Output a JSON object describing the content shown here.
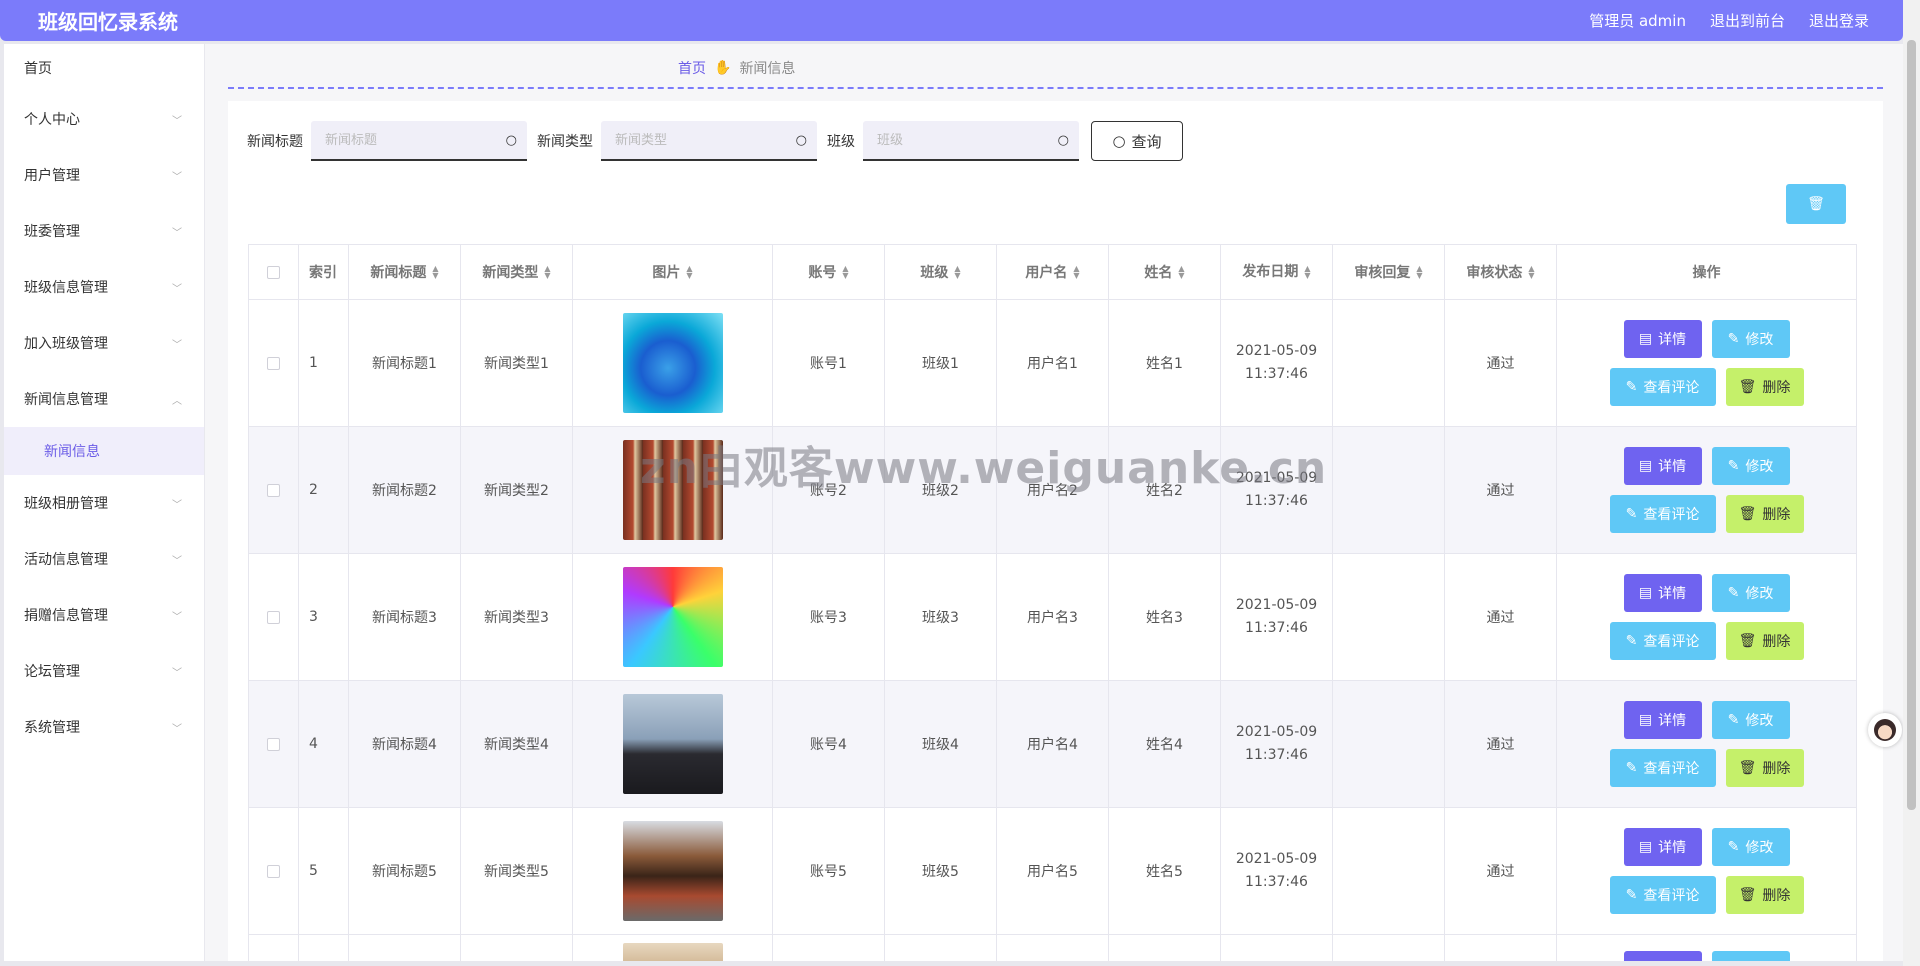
{
  "app": {
    "title": "班级回忆录系统"
  },
  "topbar": {
    "admin": "管理员 admin",
    "to_front": "退出到前台",
    "logout": "退出登录"
  },
  "sidebar": {
    "home": "首页",
    "items": [
      {
        "label": "个人中心"
      },
      {
        "label": "用户管理"
      },
      {
        "label": "班委管理"
      },
      {
        "label": "班级信息管理"
      },
      {
        "label": "加入班级管理"
      },
      {
        "label": "新闻信息管理"
      },
      {
        "label": "班级相册管理"
      },
      {
        "label": "活动信息管理"
      },
      {
        "label": "捐赠信息管理"
      },
      {
        "label": "论坛管理"
      },
      {
        "label": "系统管理"
      }
    ],
    "sub_active": "新闻信息"
  },
  "breadcrumb": {
    "home": "首页",
    "current": "新闻信息"
  },
  "search": {
    "title_label": "新闻标题",
    "title_placeholder": "新闻标题",
    "type_label": "新闻类型",
    "type_placeholder": "新闻类型",
    "class_label": "班级",
    "class_placeholder": "班级",
    "query": "查询"
  },
  "table": {
    "headers": {
      "index": "索引",
      "title": "新闻标题",
      "type": "新闻类型",
      "image": "图片",
      "account": "账号",
      "class": "班级",
      "username": "用户名",
      "name": "姓名",
      "date": "发布日期",
      "reply": "审核回复",
      "status": "审核状态",
      "ops": "操作"
    },
    "buttons": {
      "detail": "详情",
      "edit": "修改",
      "comments": "查看评论",
      "delete": "删除"
    },
    "rows": [
      {
        "index": "1",
        "title": "新闻标题1",
        "type": "新闻类型1",
        "account": "账号1",
        "class": "班级1",
        "username": "用户名1",
        "name": "姓名1",
        "date": "2021-05-09 11:37:46",
        "reply": "",
        "status": "通过"
      },
      {
        "index": "2",
        "title": "新闻标题2",
        "type": "新闻类型2",
        "account": "账号2",
        "class": "班级2",
        "username": "用户名2",
        "name": "姓名2",
        "date": "2021-05-09 11:37:46",
        "reply": "",
        "status": "通过"
      },
      {
        "index": "3",
        "title": "新闻标题3",
        "type": "新闻类型3",
        "account": "账号3",
        "class": "班级3",
        "username": "用户名3",
        "name": "姓名3",
        "date": "2021-05-09 11:37:46",
        "reply": "",
        "status": "通过"
      },
      {
        "index": "4",
        "title": "新闻标题4",
        "type": "新闻类型4",
        "account": "账号4",
        "class": "班级4",
        "username": "用户名4",
        "name": "姓名4",
        "date": "2021-05-09 11:37:46",
        "reply": "",
        "status": "通过"
      },
      {
        "index": "5",
        "title": "新闻标题5",
        "type": "新闻类型5",
        "account": "账号5",
        "class": "班级5",
        "username": "用户名5",
        "name": "姓名5",
        "date": "2021-05-09 11:37:46",
        "reply": "",
        "status": "通过"
      }
    ]
  },
  "watermark": "zn由观客www.weiguanke.cn",
  "colors": {
    "accent": "#7b7bfa",
    "detail": "#6f63f0",
    "info": "#5fc8f6",
    "delete": "#c5f06a"
  }
}
